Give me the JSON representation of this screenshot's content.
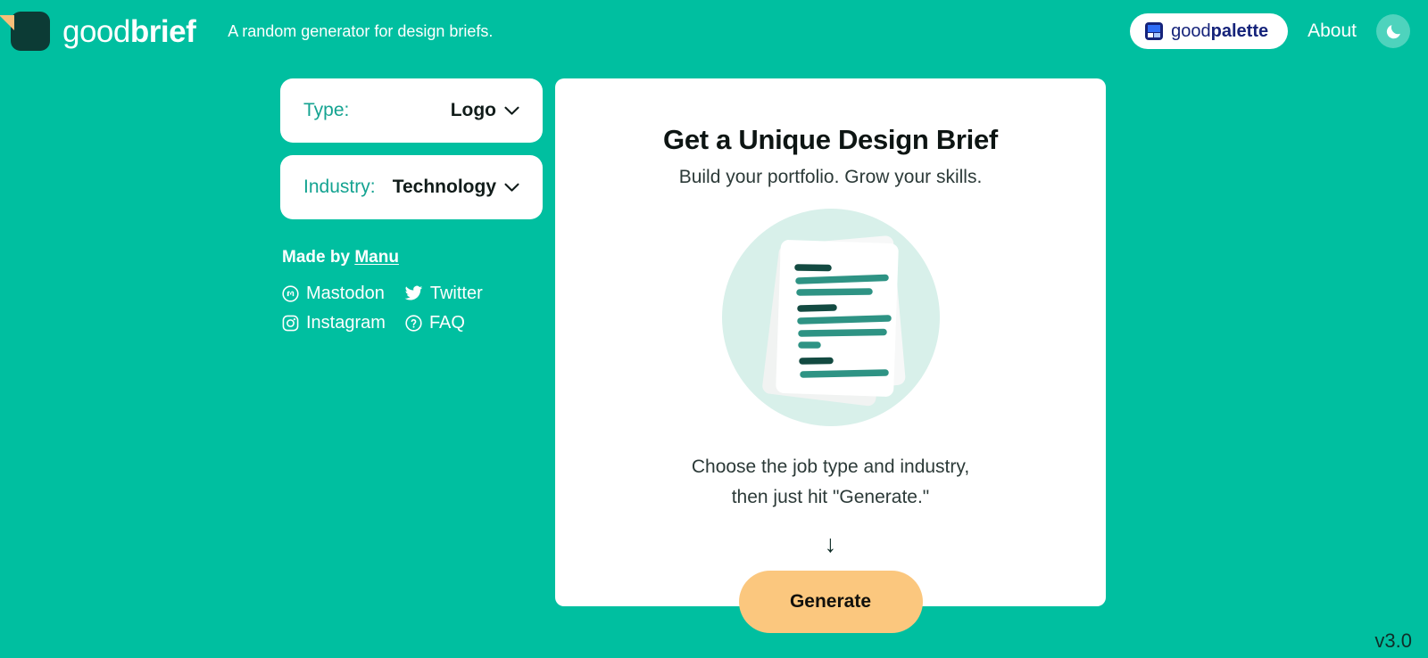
{
  "header": {
    "logo_icon": "goodbrief-document-logo",
    "brand_light": "good",
    "brand_bold": "brief",
    "tagline": "A random generator for design briefs.",
    "palette_icon": "goodpalette-squares-icon",
    "palette_light": "good",
    "palette_bold": "palette",
    "about_label": "About",
    "theme_toggle_icon": "moon-icon"
  },
  "sidebar": {
    "selects": [
      {
        "label": "Type:",
        "value": "Logo",
        "chevron": "chevron-down-icon"
      },
      {
        "label": "Industry:",
        "value": "Technology",
        "chevron": "chevron-down-icon"
      }
    ],
    "credits": {
      "made_by_prefix": "Made by ",
      "author": "Manu"
    },
    "social": [
      {
        "icon": "mastodon-icon",
        "label": "Mastodon"
      },
      {
        "icon": "twitter-icon",
        "label": "Twitter"
      },
      {
        "icon": "instagram-icon",
        "label": "Instagram"
      },
      {
        "icon": "question-mark-icon",
        "label": "FAQ"
      }
    ]
  },
  "main": {
    "title": "Get a Unique Design Brief",
    "subtitle": "Build your portfolio. Grow your skills.",
    "illustration_name": "stacked-documents-illustration",
    "hint_line1": "Choose the job type and industry,",
    "hint_line2": "then just hit \"Generate.\"",
    "arrow": "↓",
    "generate_label": "Generate"
  },
  "footer": {
    "version": "v3.0"
  },
  "colors": {
    "background": "#00bfa0",
    "card": "#ffffff",
    "accent_button": "#fbc77e",
    "label_teal": "#14a391",
    "brand_navy": "#15237a",
    "illustration_circle": "#d8f0ea",
    "illustration_line_dark": "#134a41",
    "illustration_line_mid": "#2e9384"
  }
}
